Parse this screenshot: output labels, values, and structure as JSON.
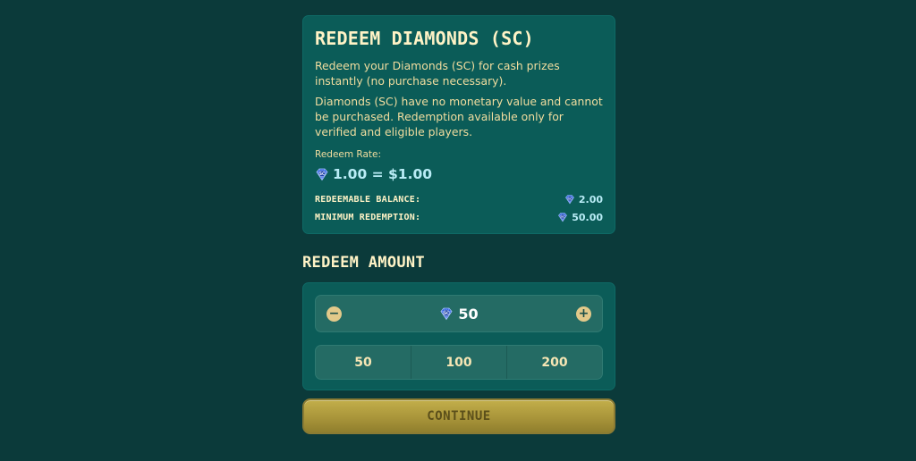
{
  "info_card": {
    "title": "REDEEM DIAMONDS (SC)",
    "paragraph_1": "Redeem your Diamonds (SC) for cash prizes instantly (no purchase necessary).",
    "paragraph_2": "Diamonds (SC) have no monetary value and cannot be purchased. Redemption available only for verified and eligible players.",
    "rate_label": "Redeem Rate:",
    "rate_value": "1.00 = $1.00",
    "redeemable_balance_label": "REDEEMABLE BALANCE:",
    "redeemable_balance_value": "2.00",
    "minimum_redemption_label": "MINIMUM REDEMPTION:",
    "minimum_redemption_value": "50.00"
  },
  "redeem_amount": {
    "title": "REDEEM AMOUNT",
    "decrement_symbol": "−",
    "increment_symbol": "+",
    "current_value": "50",
    "presets": [
      "50",
      "100",
      "200"
    ]
  },
  "continue_label": "CONTINUE",
  "icons": {
    "currency": "sc-diamond-icon",
    "decrement": "minus-circle-icon",
    "increment": "plus-circle-icon"
  },
  "colors": {
    "background": "#0b3a3a",
    "card": "#0b5c58",
    "accent_gold": "#c2ae4a",
    "title_cream": "#fff3c6",
    "value_cyan": "#b9ecf6"
  }
}
